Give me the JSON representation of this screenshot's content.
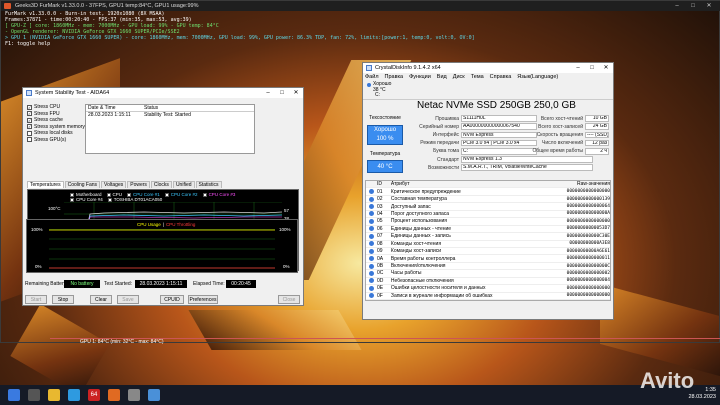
{
  "furmark": {
    "title": "Geeks3D FurMark v1.33.0.0 - 37FPS, GPU1 temp:84°C, GPU1 usage:99%",
    "overlay": [
      {
        "text": "FurMark v1.33.0.0 - Burn-in test, 1920x1080 (8X MSAA)",
        "style": "white"
      },
      {
        "text": "Frames:37871 - time:00:20:40 - FPS:37 (min:35, max:53, avg:39)",
        "style": "white"
      },
      {
        "text": "[ GPU-Z ] core: 1860MHz - mem: 7000MHz - GPU load: 99% - GPU temp: 84°C",
        "style": "green"
      },
      {
        "text": "- OpenGL renderer: NVIDIA GeForce GTX 1660 SUPER/PCIe/SSE2",
        "style": "green"
      },
      {
        "text": "> GPU 1 (NVIDIA GeForce GTX 1660 SUPER) - core: 1860MHz, mem: 7000MHz, GPU load: 99%, GPU power: 86.3% TDP, fan: 72%, limits:[power:1, temp:0, volt:0, OV:0]",
        "style": "cyan"
      },
      {
        "text": "F1: toggle help",
        "style": "white"
      }
    ],
    "temp_graph_label": "GPU 1: 84°C (min: 32°C - max: 84°C)"
  },
  "aida": {
    "title": "System Stability Test - AIDA64",
    "checks": [
      {
        "label": "Stress CPU",
        "checked": true
      },
      {
        "label": "Stress FPU",
        "checked": true
      },
      {
        "label": "Stress cache",
        "checked": true
      },
      {
        "label": "Stress system memory",
        "checked": true
      },
      {
        "label": "Stress local disks",
        "checked": false
      },
      {
        "label": "Stress GPU(s)",
        "checked": false
      }
    ],
    "table": {
      "col_date": "Date & Time",
      "col_status": "Status",
      "row_date": "28.03.2023 1:15:11",
      "row_status": "Stability Test: Started"
    },
    "tabs": [
      "Temperatures",
      "Cooling Fans",
      "Voltages",
      "Powers",
      "Clocks",
      "Unified",
      "Statistics"
    ],
    "legend": [
      {
        "label": "Motherboard",
        "color": "#ffffff"
      },
      {
        "label": "CPU",
        "color": "#ffffff"
      },
      {
        "label": "CPU Core #1",
        "color": "#3cc8ff"
      },
      {
        "label": "CPU Core #2",
        "color": "#3cc8ff"
      },
      {
        "label": "CPU Core #3",
        "color": "#ff50ff"
      },
      {
        "label": "CPU Core #4",
        "color": "#ffffff"
      }
    ],
    "legend2": "TOSHIBA DT01ACA050",
    "temp_top": "100°C",
    "temp_bottom": "0°C",
    "time_label": "1:15:11",
    "val_right_1": "57",
    "val_right_2": "38",
    "usage_title": "CPU Usage",
    "usage_sep": "|",
    "throttle_title": "CPU Throttling",
    "usage_top_left": "100%",
    "usage_bottom_left": "0%",
    "usage_top_right": "100%",
    "usage_bottom_right": "0%",
    "remaining_label": "Remaining Battery:",
    "remaining_value": "No battery",
    "started_label": "Test Started:",
    "started_value": "28.03.2023 1:15:11",
    "elapsed_label": "Elapsed Time:",
    "elapsed_value": "00:20:45",
    "buttons": {
      "start": "Start",
      "stop": "Stop",
      "clear": "Clear",
      "save": "Save",
      "cpuid": "CPUID",
      "prefs": "Preferences",
      "close": "Close"
    }
  },
  "cdi": {
    "title": "CrystalDiskInfo 9.1.4.2 x64",
    "menu": [
      "Файл",
      "Правка",
      "Функции",
      "Вид",
      "Диск",
      "Тема",
      "Справка",
      "Язык(Language)"
    ],
    "drive_status": "Хорошо",
    "drive_temp": "38 °C",
    "drive_letter": "C:",
    "model": "Netac NVMe SSD 250GB 250,0 GB",
    "health_label": "Техсостояние",
    "health_status": "Хорошо",
    "health_pct": "100 %",
    "temp_label": "Температура",
    "temp_value": "40 °C",
    "props_left": [
      {
        "k": "Прошивка",
        "v": "S1111H0L"
      },
      {
        "k": "Серийный номер",
        "v": "AA000000000000067540"
      },
      {
        "k": "Интерфейс",
        "v": "NVM Express"
      },
      {
        "k": "Режим передачи",
        "v": "PCIe 3.0 x4 | PCIe 3.0 x4"
      },
      {
        "k": "Буква тома",
        "v": "C:"
      },
      {
        "k": "Стандарт",
        "v": "NVM Express 1.3"
      },
      {
        "k": "Возможности",
        "v": "S.M.A.R.T., TRIM, VolatileWriteCache"
      }
    ],
    "props_right": [
      {
        "k": "Всего хост-чтений",
        "v": "10 GB"
      },
      {
        "k": "Всего хост-записей",
        "v": "24 GB"
      },
      {
        "k": "Скорость вращения",
        "v": "---- (SSD)"
      },
      {
        "k": "Число включений",
        "v": "12 раз"
      },
      {
        "k": "Общее время работы",
        "v": "2 ч"
      }
    ],
    "smart_headers": {
      "id": "ID",
      "name": "Атрибут",
      "raw": "Raw-значения"
    },
    "smart": [
      {
        "id": "01",
        "name": "Критическое предупреждение",
        "raw": "0000000000000000"
      },
      {
        "id": "02",
        "name": "Составная температура",
        "raw": "0000000000000139"
      },
      {
        "id": "03",
        "name": "Доступный запас",
        "raw": "0000000000000064"
      },
      {
        "id": "04",
        "name": "Порог доступного запаса",
        "raw": "000000000000000A"
      },
      {
        "id": "05",
        "name": "Процент использования",
        "raw": "0000000000000000"
      },
      {
        "id": "06",
        "name": "Единицы данных - чтение",
        "raw": "00000000000053D7"
      },
      {
        "id": "07",
        "name": "Единицы данных - запись",
        "raw": "000000000000C30E"
      },
      {
        "id": "08",
        "name": "Команды хост-чтения",
        "raw": "00000000000A3E8"
      },
      {
        "id": "09",
        "name": "Команды хост-записи",
        "raw": "00000000000A6E61"
      },
      {
        "id": "0A",
        "name": "Время работы контроллера",
        "raw": "0000000000000011"
      },
      {
        "id": "0B",
        "name": "Включения/отключения",
        "raw": "000000000000000C"
      },
      {
        "id": "0C",
        "name": "Часы работы",
        "raw": "0000000000000002"
      },
      {
        "id": "0D",
        "name": "Небезопасные отключения",
        "raw": "0000000000000004"
      },
      {
        "id": "0E",
        "name": "Ошибки целостности носителя и данных",
        "raw": "0000000000000000"
      },
      {
        "id": "0F",
        "name": "Записи в журнале информации об ошибках",
        "raw": "0000000000000000"
      }
    ]
  },
  "taskbar": {
    "badge": "64",
    "time": "1:35",
    "date": "28.03.2023"
  },
  "watermark": "Avito"
}
